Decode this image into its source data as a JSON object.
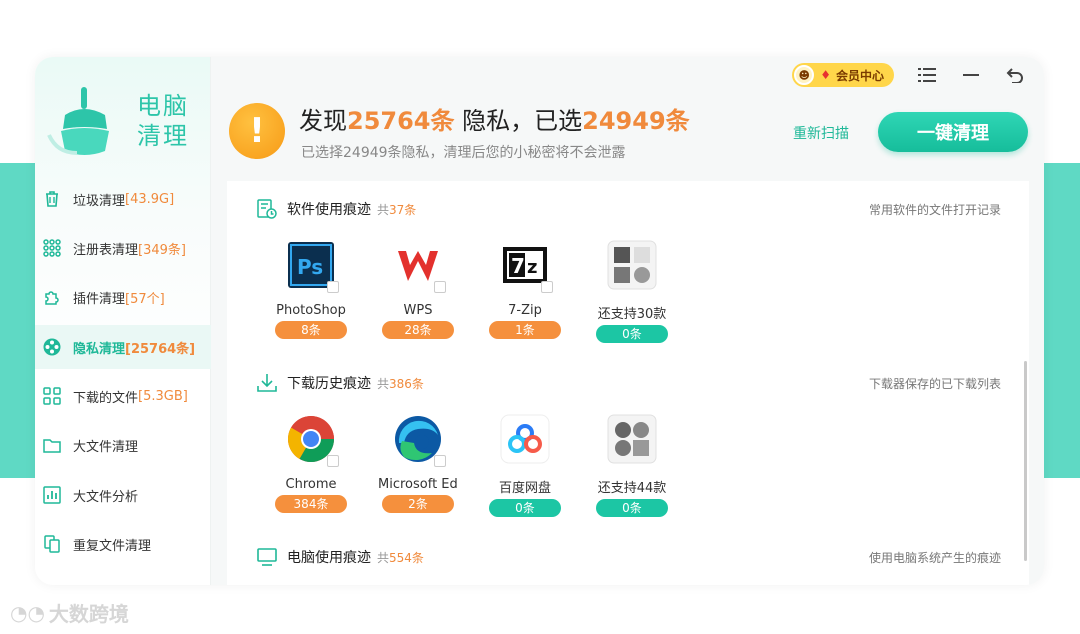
{
  "app": {
    "logo_line1": "电脑",
    "logo_line2": "清理"
  },
  "sidebar": {
    "items": [
      {
        "label": "垃圾清理",
        "count": "[43.9G]",
        "icon": "trash-icon"
      },
      {
        "label": "注册表清理",
        "count": "[349条]",
        "icon": "registry-icon"
      },
      {
        "label": "插件清理",
        "count": "[57个]",
        "icon": "plugin-icon"
      },
      {
        "label": "隐私清理",
        "count": "[25764条]",
        "icon": "privacy-icon",
        "active": true
      },
      {
        "label": "下载的文件",
        "count": "[5.3GB]",
        "icon": "download-files-icon"
      },
      {
        "label": "大文件清理",
        "count": "",
        "icon": "folder-icon"
      },
      {
        "label": "大文件分析",
        "count": "",
        "icon": "chart-icon"
      },
      {
        "label": "重复文件清理",
        "count": "",
        "icon": "duplicate-icon"
      }
    ]
  },
  "topbar": {
    "vip_label": "会员中心"
  },
  "header": {
    "found_prefix": "发现",
    "found_count": "25764条",
    "found_mid": "隐私，已选",
    "selected_count": "24949条",
    "subtitle": "已选择24949条隐私，清理后您的小秘密将不会泄露",
    "rescan": "重新扫描",
    "clean_button": "一键清理"
  },
  "sections": [
    {
      "title": "软件使用痕迹",
      "total_prefix": "共",
      "total": "37条",
      "note": "常用软件的文件打开记录",
      "apps": [
        {
          "name": "PhotoShop",
          "count": "8条",
          "color": "orange",
          "icon": "photoshop-icon"
        },
        {
          "name": "WPS",
          "count": "28条",
          "color": "orange",
          "icon": "wps-icon"
        },
        {
          "name": "7-Zip",
          "count": "1条",
          "color": "orange",
          "icon": "7zip-icon"
        },
        {
          "name": "还支持30款",
          "count": "0条",
          "color": "green",
          "icon": "more-apps-icon"
        }
      ]
    },
    {
      "title": "下载历史痕迹",
      "total_prefix": "共",
      "total": "386条",
      "note": "下载器保存的已下载列表",
      "apps": [
        {
          "name": "Chrome",
          "count": "384条",
          "color": "orange",
          "icon": "chrome-icon"
        },
        {
          "name": "Microsoft Edge",
          "count": "2条",
          "color": "orange",
          "icon": "edge-icon"
        },
        {
          "name": "百度网盘",
          "count": "0条",
          "color": "green",
          "icon": "baidu-netdisk-icon"
        },
        {
          "name": "还支持44款",
          "count": "0条",
          "color": "green",
          "icon": "more-apps-icon"
        }
      ]
    },
    {
      "title": "电脑使用痕迹",
      "total_prefix": "共",
      "total": "554条",
      "note": "使用电脑系统产生的痕迹",
      "apps": []
    }
  ],
  "watermark": "大数跨境",
  "colors": {
    "accent": "#1fb898",
    "highlight": "#f08a3c",
    "band": "#5fd9c4"
  }
}
